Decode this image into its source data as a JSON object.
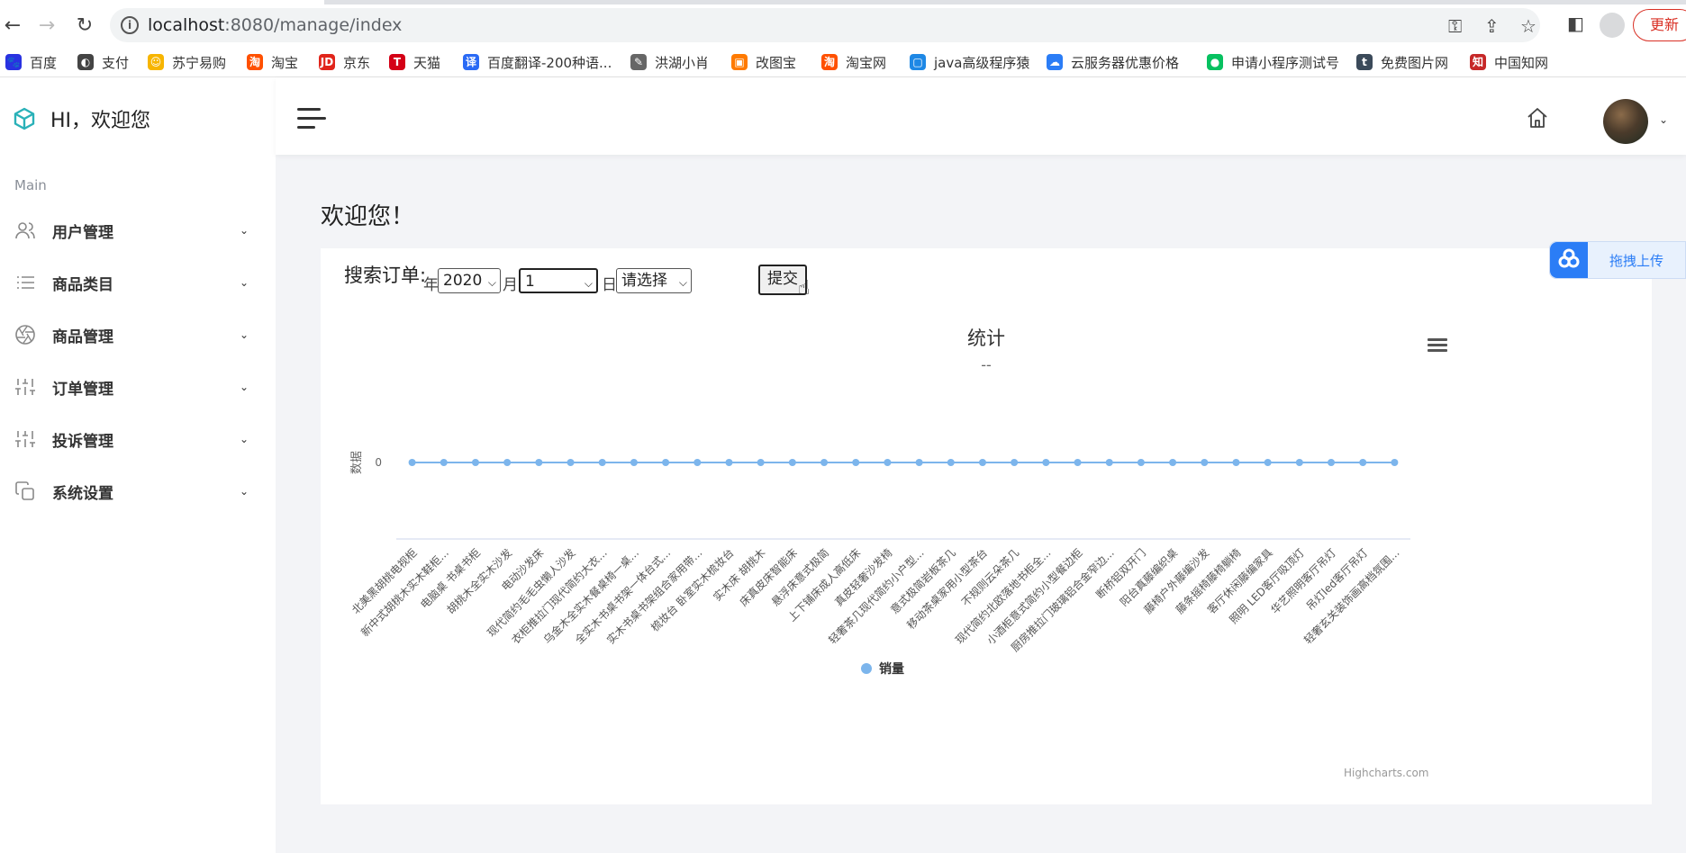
{
  "browser": {
    "url_host": "localhost",
    "url_path": ":8080/manage/index",
    "update_label": "更新"
  },
  "bookmarks": [
    {
      "label": "百度",
      "color": "#2932e1",
      "glyph": "🐾"
    },
    {
      "label": "支付",
      "color": "#444444",
      "glyph": "◐"
    },
    {
      "label": "苏宁易购",
      "color": "#f7b500",
      "glyph": "☺"
    },
    {
      "label": "淘宝",
      "color": "#ff5000",
      "glyph": "淘"
    },
    {
      "label": "京东",
      "color": "#e1251b",
      "glyph": "JD"
    },
    {
      "label": "天猫",
      "color": "#d40016",
      "glyph": "T"
    },
    {
      "label": "百度翻译-200种语...",
      "color": "#2a6af5",
      "glyph": "译"
    },
    {
      "label": "洪湖小肖",
      "color": "#666666",
      "glyph": "✎"
    },
    {
      "label": "改图宝",
      "color": "#ff7a00",
      "glyph": "▣"
    },
    {
      "label": "淘宝网",
      "color": "#ff5000",
      "glyph": "淘"
    },
    {
      "label": "java高级程序猿",
      "color": "#1e88e5",
      "glyph": "▢"
    },
    {
      "label": "云服务器优惠价格",
      "color": "#2b7df6",
      "glyph": "☁"
    },
    {
      "label": "申请小程序测试号",
      "color": "#07c160",
      "glyph": "●"
    },
    {
      "label": "免费图片网",
      "color": "#3b4a5a",
      "glyph": "t"
    },
    {
      "label": "中国知网",
      "color": "#c62828",
      "glyph": "知"
    }
  ],
  "sidebar": {
    "brand": "HI，欢迎您",
    "section_label": "Main",
    "items": [
      {
        "label": "用户管理",
        "icon": "users-icon"
      },
      {
        "label": "商品类目",
        "icon": "list-icon"
      },
      {
        "label": "商品管理",
        "icon": "aperture-icon"
      },
      {
        "label": "订单管理",
        "icon": "sliders-icon"
      },
      {
        "label": "投诉管理",
        "icon": "sliders-icon"
      },
      {
        "label": "系统设置",
        "icon": "copy-icon"
      }
    ]
  },
  "page": {
    "welcome": "欢迎您！"
  },
  "search": {
    "label": "搜索订单:",
    "year_label": "年",
    "year_value": "2020",
    "month_label": "月",
    "month_value": "1",
    "day_label": "日",
    "day_value": "请选择",
    "submit_label": "提交"
  },
  "upload": {
    "label": "拖拽上传"
  },
  "chart_data": {
    "type": "line",
    "title": "统计",
    "subtitle": "--",
    "ylabel": "数据",
    "xlabel": "",
    "ylim": [
      0,
      0
    ],
    "y_ticks": [
      "0"
    ],
    "categories": [
      "北美黑胡桃电视柜",
      "新中式胡桃木实木鞋柜...",
      "电脑桌 书桌书柜",
      "胡桃木全实木沙发",
      "电动沙发床",
      "现代简约毛毛虫懒人沙发",
      "衣柜推拉门现代简约大衣...",
      "乌金木全实木餐桌椅一桌...",
      "全实木书桌书架一体台式...",
      "实木书桌书架组合家用带...",
      "梳妆台 卧室实木梳妆台",
      "实木床 胡桃木",
      "床真皮床智能床",
      "悬浮床意式极简",
      "上下铺床成人高低床",
      "真皮轻奢沙发椅",
      "轻奢茶几现代简约小户型...",
      "意式极简岩板茶几",
      "移动茶桌家用小型茶台",
      "不规则云朵茶几",
      "现代简约北欧落地书柜全...",
      "小酒柜意式简约小型餐边柜",
      "厨房推拉门玻璃铝合金窄边...",
      "断桥铝双开门",
      "阳台真藤编织桌",
      "藤椅户外藤编沙发",
      "藤条摇椅藤椅躺椅",
      "客厅休闲藤编家具",
      "照明 LED客厅吸顶灯",
      "华艺照明客厅吊灯",
      "吊灯led客厅吊灯",
      "轻奢玄关装饰画高档氛围..."
    ],
    "series": [
      {
        "name": "销量",
        "values": [
          0,
          0,
          0,
          0,
          0,
          0,
          0,
          0,
          0,
          0,
          0,
          0,
          0,
          0,
          0,
          0,
          0,
          0,
          0,
          0,
          0,
          0,
          0,
          0,
          0,
          0,
          0,
          0,
          0,
          0,
          0,
          0
        ],
        "color": "#7cb5ec"
      }
    ],
    "legend": "bottom-center",
    "grid": true,
    "credits": "Highcharts.com"
  }
}
